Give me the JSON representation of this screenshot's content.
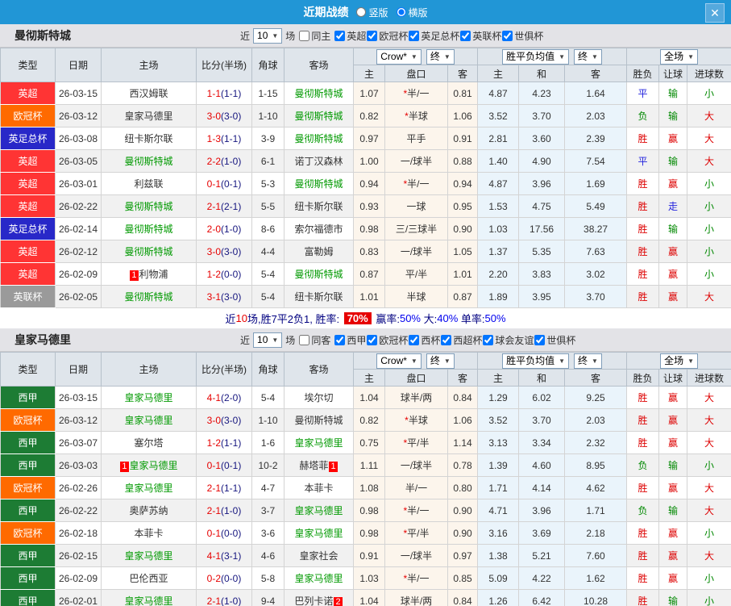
{
  "icons": {
    "close": "✕",
    "caret": "▼"
  },
  "topbar": {
    "title": "近期战绩",
    "vertical_label": "竖版",
    "horizontal_label": "横版"
  },
  "columns": {
    "type": "类型",
    "date": "日期",
    "home": "主场",
    "score": "比分(半场)",
    "corner": "角球",
    "away": "客场",
    "h": "主",
    "handicap": "盘口",
    "a": "客",
    "w": "主",
    "d": "和",
    "l": "客",
    "wdl": "胜负",
    "let_ball": "让球",
    "goals": "进球数"
  },
  "selects": {
    "company": "Crow*",
    "final": "终",
    "avg": "胜平负均值",
    "scope": "全场"
  },
  "type_colors": {
    "英超": "#ff3434",
    "欧冠杯": "#ff6a00",
    "英足总杯": "#2828c8",
    "英联杯": "#9a9a9a",
    "西甲": "#1d7c34"
  },
  "result_colors": {
    "胜": "#dd0000",
    "负": "#008800",
    "平": "#2222dd",
    "赢": "#dd0000",
    "输": "#008800",
    "走": "#2222dd",
    "大": "#dd0000",
    "小": "#008800"
  },
  "sections": [
    {
      "team": "曼彻斯特城",
      "filter": {
        "prefix": "近",
        "count": "10",
        "suffix": "场",
        "same": "同主",
        "leagues": [
          "英超",
          "欧冠杯",
          "英足总杯",
          "英联杯",
          "世俱杯"
        ]
      },
      "rows": [
        {
          "type": "英超",
          "date": "26-03-15",
          "home": "西汉姆联",
          "home_green": false,
          "away": "曼彻斯特城",
          "away_green": true,
          "ft": "1-1",
          "half": "(1-1)",
          "corner": "1-15",
          "h": "1.07",
          "hcp": "*半/一",
          "a": "0.81",
          "w": "4.87",
          "d": "4.23",
          "l": "1.64",
          "r1": "平",
          "r2": "输",
          "r3": "小"
        },
        {
          "type": "欧冠杯",
          "date": "26-03-12",
          "home": "皇家马德里",
          "home_green": false,
          "away": "曼彻斯特城",
          "away_green": true,
          "ft": "3-0",
          "half": "(3-0)",
          "corner": "1-10",
          "h": "0.82",
          "hcp": "*半球",
          "a": "1.06",
          "w": "3.52",
          "d": "3.70",
          "l": "2.03",
          "r1": "负",
          "r2": "输",
          "r3": "大"
        },
        {
          "type": "英足总杯",
          "date": "26-03-08",
          "home": "纽卡斯尔联",
          "home_green": false,
          "away": "曼彻斯特城",
          "away_green": true,
          "ft": "1-3",
          "half": "(1-1)",
          "corner": "3-9",
          "h": "0.97",
          "hcp": "平手",
          "a": "0.91",
          "w": "2.81",
          "d": "3.60",
          "l": "2.39",
          "r1": "胜",
          "r2": "赢",
          "r3": "大"
        },
        {
          "type": "英超",
          "date": "26-03-05",
          "home": "曼彻斯特城",
          "home_green": true,
          "away": "诺丁汉森林",
          "away_green": false,
          "ft": "2-2",
          "half": "(1-0)",
          "corner": "6-1",
          "h": "1.00",
          "hcp": "一/球半",
          "a": "0.88",
          "w": "1.40",
          "d": "4.90",
          "l": "7.54",
          "r1": "平",
          "r2": "输",
          "r3": "大"
        },
        {
          "type": "英超",
          "date": "26-03-01",
          "home": "利兹联",
          "home_green": false,
          "away": "曼彻斯特城",
          "away_green": true,
          "ft": "0-1",
          "half": "(0-1)",
          "corner": "5-3",
          "h": "0.94",
          "hcp": "*半/一",
          "a": "0.94",
          "w": "4.87",
          "d": "3.96",
          "l": "1.69",
          "r1": "胜",
          "r2": "赢",
          "r3": "小"
        },
        {
          "type": "英超",
          "date": "26-02-22",
          "home": "曼彻斯特城",
          "home_green": true,
          "away": "纽卡斯尔联",
          "away_green": false,
          "ft": "2-1",
          "half": "(2-1)",
          "corner": "5-5",
          "h": "0.93",
          "hcp": "一球",
          "a": "0.95",
          "w": "1.53",
          "d": "4.75",
          "l": "5.49",
          "r1": "胜",
          "r2": "走",
          "r3": "小"
        },
        {
          "type": "英足总杯",
          "date": "26-02-14",
          "home": "曼彻斯特城",
          "home_green": true,
          "away": "索尔福德市",
          "away_green": false,
          "ft": "2-0",
          "half": "(1-0)",
          "corner": "8-6",
          "h": "0.98",
          "hcp": "三/三球半",
          "a": "0.90",
          "w": "1.03",
          "d": "17.56",
          "l": "38.27",
          "r1": "胜",
          "r2": "输",
          "r3": "小"
        },
        {
          "type": "英超",
          "date": "26-02-12",
          "home": "曼彻斯特城",
          "home_green": true,
          "away": "富勒姆",
          "away_green": false,
          "ft": "3-0",
          "half": "(3-0)",
          "corner": "4-4",
          "h": "0.83",
          "hcp": "一/球半",
          "a": "1.05",
          "w": "1.37",
          "d": "5.35",
          "l": "7.63",
          "r1": "胜",
          "r2": "赢",
          "r3": "小"
        },
        {
          "type": "英超",
          "date": "26-02-09",
          "home": "利物浦",
          "home_green": false,
          "home_badge": "1",
          "away": "曼彻斯特城",
          "away_green": true,
          "ft": "1-2",
          "half": "(0-0)",
          "corner": "5-4",
          "h": "0.87",
          "hcp": "平/半",
          "a": "1.01",
          "w": "2.20",
          "d": "3.83",
          "l": "3.02",
          "r1": "胜",
          "r2": "赢",
          "r3": "小"
        },
        {
          "type": "英联杯",
          "date": "26-02-05",
          "home": "曼彻斯特城",
          "home_green": true,
          "away": "纽卡斯尔联",
          "away_green": false,
          "ft": "3-1",
          "half": "(3-0)",
          "corner": "5-4",
          "h": "1.01",
          "hcp": "半球",
          "a": "0.87",
          "w": "1.89",
          "d": "3.95",
          "l": "3.70",
          "r1": "胜",
          "r2": "赢",
          "r3": "大"
        }
      ],
      "summary": [
        {
          "t": "近",
          "s": "navy"
        },
        {
          "t": "10",
          "s": "red"
        },
        {
          "t": "场,胜7平2负1, 胜率: ",
          "s": "navy"
        },
        {
          "t": "70%",
          "s": "badge"
        },
        {
          "t": " 赢率:",
          "s": "navy"
        },
        {
          "t": "50%",
          "s": "blue"
        },
        {
          "t": " 大:",
          "s": "navy"
        },
        {
          "t": "40%",
          "s": "blue"
        },
        {
          "t": " 单率:",
          "s": "navy"
        },
        {
          "t": "50%",
          "s": "blue"
        }
      ]
    },
    {
      "team": "皇家马德里",
      "filter": {
        "prefix": "近",
        "count": "10",
        "suffix": "场",
        "same": "同客",
        "leagues": [
          "西甲",
          "欧冠杯",
          "西杯",
          "西超杯",
          "球会友谊",
          "世俱杯"
        ]
      },
      "rows": [
        {
          "type": "西甲",
          "date": "26-03-15",
          "home": "皇家马德里",
          "home_green": true,
          "away": "埃尔切",
          "away_green": false,
          "ft": "4-1",
          "half": "(2-0)",
          "corner": "5-4",
          "h": "1.04",
          "hcp": "球半/两",
          "a": "0.84",
          "w": "1.29",
          "d": "6.02",
          "l": "9.25",
          "r1": "胜",
          "r2": "赢",
          "r3": "大"
        },
        {
          "type": "欧冠杯",
          "date": "26-03-12",
          "home": "皇家马德里",
          "home_green": true,
          "away": "曼彻斯特城",
          "away_green": false,
          "ft": "3-0",
          "half": "(3-0)",
          "corner": "1-10",
          "h": "0.82",
          "hcp": "*半球",
          "a": "1.06",
          "w": "3.52",
          "d": "3.70",
          "l": "2.03",
          "r1": "胜",
          "r2": "赢",
          "r3": "大"
        },
        {
          "type": "西甲",
          "date": "26-03-07",
          "home": "塞尔塔",
          "home_green": false,
          "away": "皇家马德里",
          "away_green": true,
          "ft": "1-2",
          "half": "(1-1)",
          "corner": "1-6",
          "h": "0.75",
          "hcp": "*平/半",
          "a": "1.14",
          "w": "3.13",
          "d": "3.34",
          "l": "2.32",
          "r1": "胜",
          "r2": "赢",
          "r3": "大"
        },
        {
          "type": "西甲",
          "date": "26-03-03",
          "home": "皇家马德里",
          "home_green": true,
          "home_badge": "1",
          "away": "赫塔菲",
          "away_green": false,
          "away_badge": "1",
          "ft": "0-1",
          "half": "(0-1)",
          "corner": "10-2",
          "h": "1.11",
          "hcp": "一/球半",
          "a": "0.78",
          "w": "1.39",
          "d": "4.60",
          "l": "8.95",
          "r1": "负",
          "r2": "输",
          "r3": "小"
        },
        {
          "type": "欧冠杯",
          "date": "26-02-26",
          "home": "皇家马德里",
          "home_green": true,
          "away": "本菲卡",
          "away_green": false,
          "ft": "2-1",
          "half": "(1-1)",
          "corner": "4-7",
          "h": "1.08",
          "hcp": "半/一",
          "a": "0.80",
          "w": "1.71",
          "d": "4.14",
          "l": "4.62",
          "r1": "胜",
          "r2": "赢",
          "r3": "大"
        },
        {
          "type": "西甲",
          "date": "26-02-22",
          "home": "奥萨苏纳",
          "home_green": false,
          "away": "皇家马德里",
          "away_green": true,
          "ft": "2-1",
          "half": "(1-0)",
          "corner": "3-7",
          "h": "0.98",
          "hcp": "*半/一",
          "a": "0.90",
          "w": "4.71",
          "d": "3.96",
          "l": "1.71",
          "r1": "负",
          "r2": "输",
          "r3": "大"
        },
        {
          "type": "欧冠杯",
          "date": "26-02-18",
          "home": "本菲卡",
          "home_green": false,
          "away": "皇家马德里",
          "away_green": true,
          "ft": "0-1",
          "half": "(0-0)",
          "corner": "3-6",
          "h": "0.98",
          "hcp": "*平/半",
          "a": "0.90",
          "w": "3.16",
          "d": "3.69",
          "l": "2.18",
          "r1": "胜",
          "r2": "赢",
          "r3": "小"
        },
        {
          "type": "西甲",
          "date": "26-02-15",
          "home": "皇家马德里",
          "home_green": true,
          "away": "皇家社会",
          "away_green": false,
          "ft": "4-1",
          "half": "(3-1)",
          "corner": "4-6",
          "h": "0.91",
          "hcp": "一/球半",
          "a": "0.97",
          "w": "1.38",
          "d": "5.21",
          "l": "7.60",
          "r1": "胜",
          "r2": "赢",
          "r3": "大"
        },
        {
          "type": "西甲",
          "date": "26-02-09",
          "home": "巴伦西亚",
          "home_green": false,
          "away": "皇家马德里",
          "away_green": true,
          "ft": "0-2",
          "half": "(0-0)",
          "corner": "5-8",
          "h": "1.03",
          "hcp": "*半/一",
          "a": "0.85",
          "w": "5.09",
          "d": "4.22",
          "l": "1.62",
          "r1": "胜",
          "r2": "赢",
          "r3": "小"
        },
        {
          "type": "西甲",
          "date": "26-02-01",
          "home": "皇家马德里",
          "home_green": true,
          "away": "巴列卡诺",
          "away_green": false,
          "away_badge": "2",
          "ft": "2-1",
          "half": "(1-0)",
          "corner": "9-4",
          "h": "1.04",
          "hcp": "球半/两",
          "a": "0.84",
          "w": "1.26",
          "d": "6.42",
          "l": "10.28",
          "r1": "胜",
          "r2": "输",
          "r3": "小"
        }
      ],
      "summary": []
    }
  ]
}
